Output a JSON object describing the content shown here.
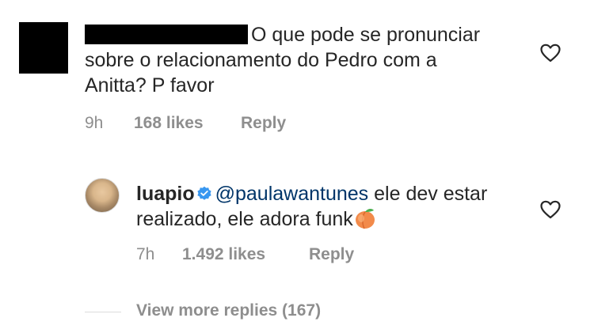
{
  "comment": {
    "text": "O que pode se pronunciar sobre o relacionamento do Pedro com a Anitta?  P favor",
    "time": "9h",
    "likes": "168 likes",
    "reply_label": "Reply"
  },
  "reply": {
    "username": "luapio",
    "mention": "@paulawantunes",
    "text": " ele dev estar realizado, ele adora funk",
    "time": "7h",
    "likes": "1.492 likes",
    "reply_label": "Reply"
  },
  "view_more": "View more replies (167)",
  "icons": {
    "like": "heart-outline-icon",
    "verified": "verified-badge-icon",
    "emoji": "peach-emoji"
  },
  "colors": {
    "text": "#262626",
    "meta": "#8e8e8e",
    "mention": "#003569",
    "verified": "#3897f0"
  }
}
